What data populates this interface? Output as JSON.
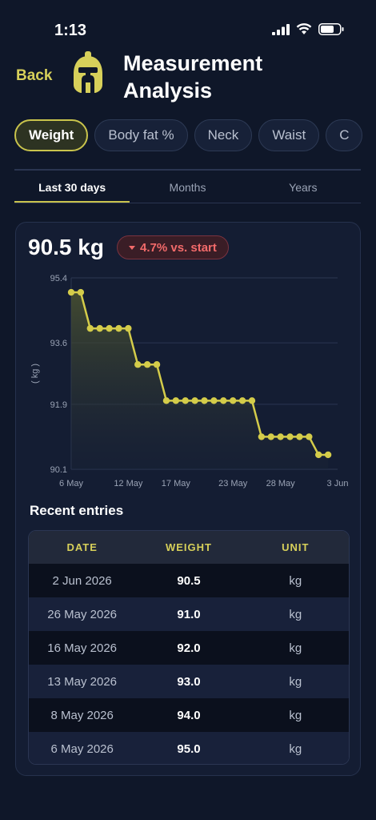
{
  "status_bar": {
    "time": "1:13"
  },
  "header": {
    "back_label": "Back",
    "title": "Measurement Analysis"
  },
  "chips": [
    "Weight",
    "Body fat %",
    "Neck",
    "Waist",
    "C"
  ],
  "active_chip": "Weight",
  "tabs": [
    "Last 30 days",
    "Months",
    "Years"
  ],
  "active_tab": "Last 30 days",
  "summary": {
    "value": "90.5 kg",
    "delta": "4.7% vs. start"
  },
  "colors": {
    "accent": "#c9c44c",
    "negative": "#f26a6a",
    "background": "#0f1729"
  },
  "chart_data": {
    "type": "line",
    "ylabel": "( kg )",
    "y_ticks": [
      "95.4",
      "93.6",
      "91.9",
      "90.1"
    ],
    "ylim": [
      90.1,
      95.4
    ],
    "x_ticks": [
      "6 May",
      "12 May",
      "17 May",
      "23 May",
      "28 May",
      "3 Jun"
    ],
    "series": [
      {
        "x": [
          "2026-05-06",
          "2026-05-07",
          "2026-05-08",
          "2026-05-09",
          "2026-05-10",
          "2026-05-11",
          "2026-05-12",
          "2026-05-13",
          "2026-05-14",
          "2026-05-15",
          "2026-05-16",
          "2026-05-17",
          "2026-05-18",
          "2026-05-19",
          "2026-05-20",
          "2026-05-21",
          "2026-05-22",
          "2026-05-23",
          "2026-05-24",
          "2026-05-25",
          "2026-05-26",
          "2026-05-27",
          "2026-05-28",
          "2026-05-29",
          "2026-05-30",
          "2026-05-31",
          "2026-06-01",
          "2026-06-02"
        ],
        "values": [
          95.0,
          95.0,
          94.0,
          94.0,
          94.0,
          94.0,
          94.0,
          93.0,
          93.0,
          93.0,
          92.0,
          92.0,
          92.0,
          92.0,
          92.0,
          92.0,
          92.0,
          92.0,
          92.0,
          92.0,
          91.0,
          91.0,
          91.0,
          91.0,
          91.0,
          91.0,
          90.5,
          90.5
        ]
      }
    ],
    "grid": true
  },
  "recent": {
    "title": "Recent entries",
    "columns": [
      "DATE",
      "WEIGHT",
      "UNIT"
    ],
    "rows": [
      [
        "2 Jun 2026",
        "90.5",
        "kg"
      ],
      [
        "26 May 2026",
        "91.0",
        "kg"
      ],
      [
        "16 May 2026",
        "92.0",
        "kg"
      ],
      [
        "13 May 2026",
        "93.0",
        "kg"
      ],
      [
        "8 May 2026",
        "94.0",
        "kg"
      ],
      [
        "6 May 2026",
        "95.0",
        "kg"
      ]
    ]
  }
}
